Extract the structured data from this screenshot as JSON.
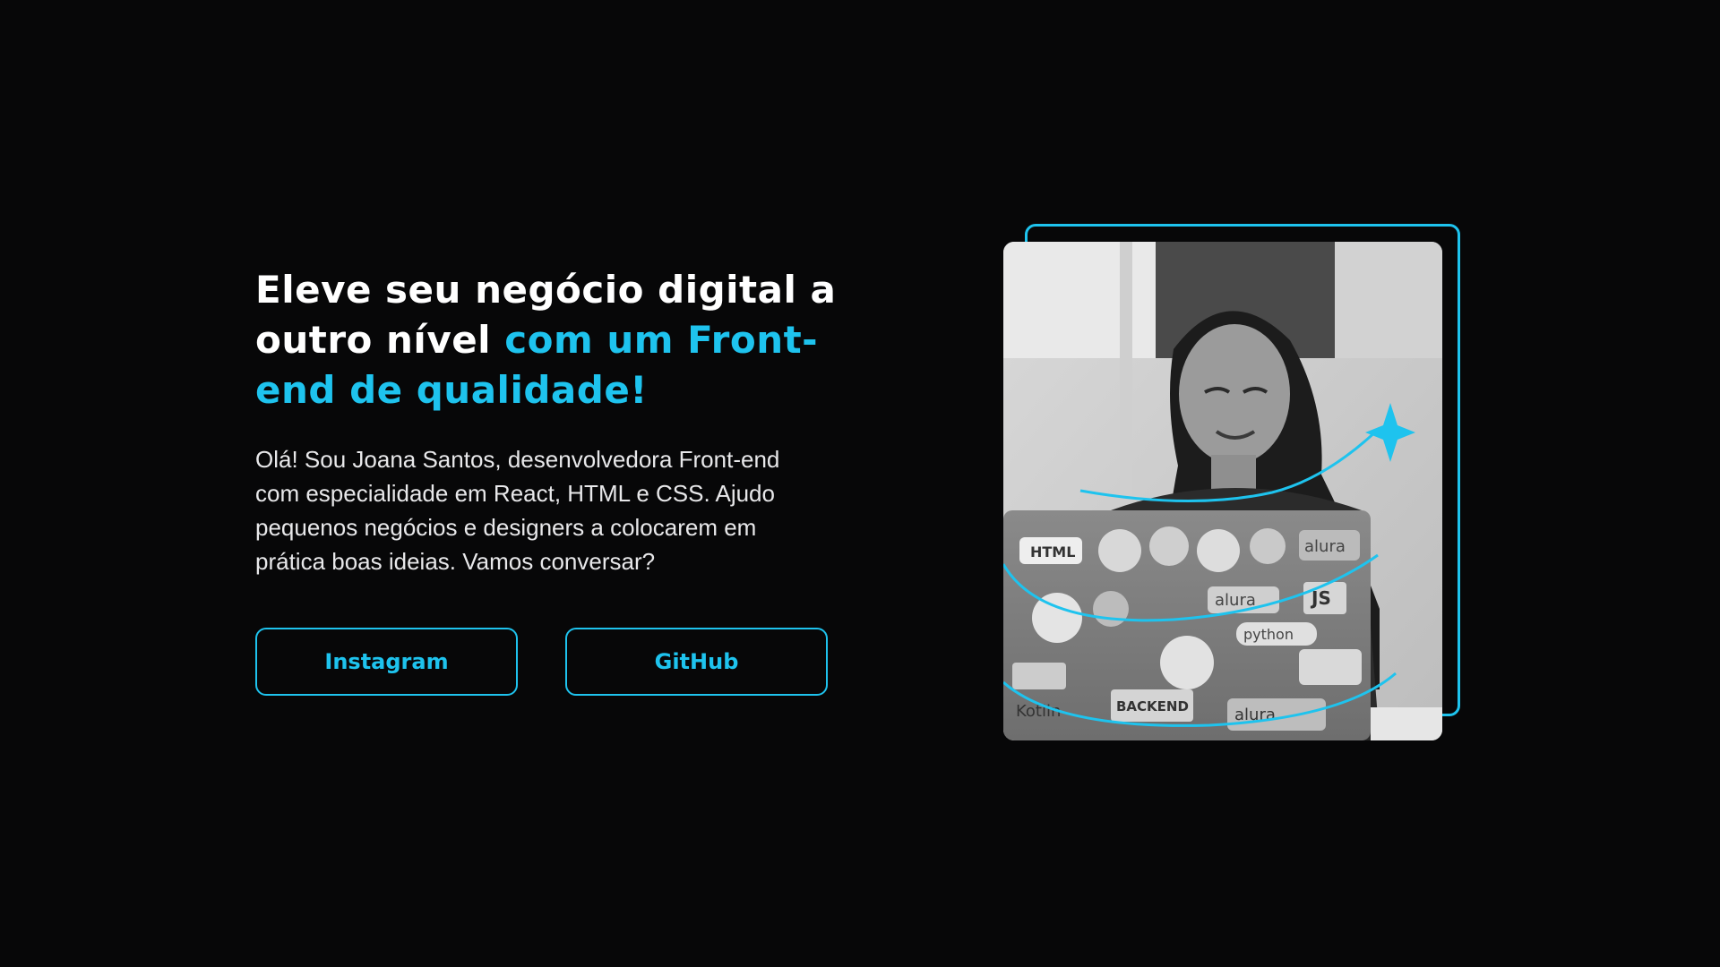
{
  "hero": {
    "headline": {
      "part1": "Eleve seu negócio digital a outro nível ",
      "part2_accent": "com um Front-end de qualidade!"
    },
    "intro": "Olá! Sou Joana Santos, desenvolvedora Front-end com especialidade em React, HTML e CSS. Ajudo pequenos negócios e designers a colocarem em prática boas ideias. Vamos conversar?",
    "buttons": {
      "instagram_label": "Instagram",
      "github_label": "GitHub"
    }
  },
  "photo": {
    "stickers": [
      "HTML",
      "alura",
      "JS",
      "alura",
      "python",
      "BACKEND",
      "Kotlin",
      "alura"
    ]
  },
  "colors": {
    "background": "#070708",
    "accent": "#1ec3ee",
    "text": "#ffffff"
  }
}
